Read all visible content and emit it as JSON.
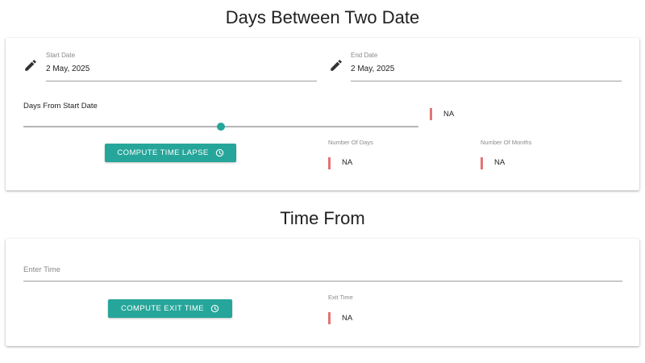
{
  "sections": {
    "days_between": {
      "title": "Days Between Two Date",
      "start_date": {
        "label": "Start Date",
        "value": "2 May, 2025"
      },
      "end_date": {
        "label": "End Date",
        "value": "2 May, 2025"
      },
      "slider": {
        "label": "Days From Start Date",
        "value_fraction": 0.5,
        "readout": "NA"
      },
      "compute_button": {
        "label": "COMPUTE TIME LAPSE",
        "icon": "clock-icon"
      },
      "number_of_days": {
        "label": "Number Of Days",
        "value": "NA"
      },
      "number_of_months": {
        "label": "Number Of Months",
        "value": "NA"
      }
    },
    "time_from": {
      "title": "Time From",
      "enter_time": {
        "placeholder": "Enter Time",
        "value": ""
      },
      "compute_button": {
        "label": "COMPUTE EXIT TIME",
        "icon": "clock-icon"
      },
      "exit_time": {
        "label": "Exit Time",
        "value": "NA"
      }
    }
  },
  "colors": {
    "accent": "#26a69a",
    "indicator": "#e57373"
  }
}
